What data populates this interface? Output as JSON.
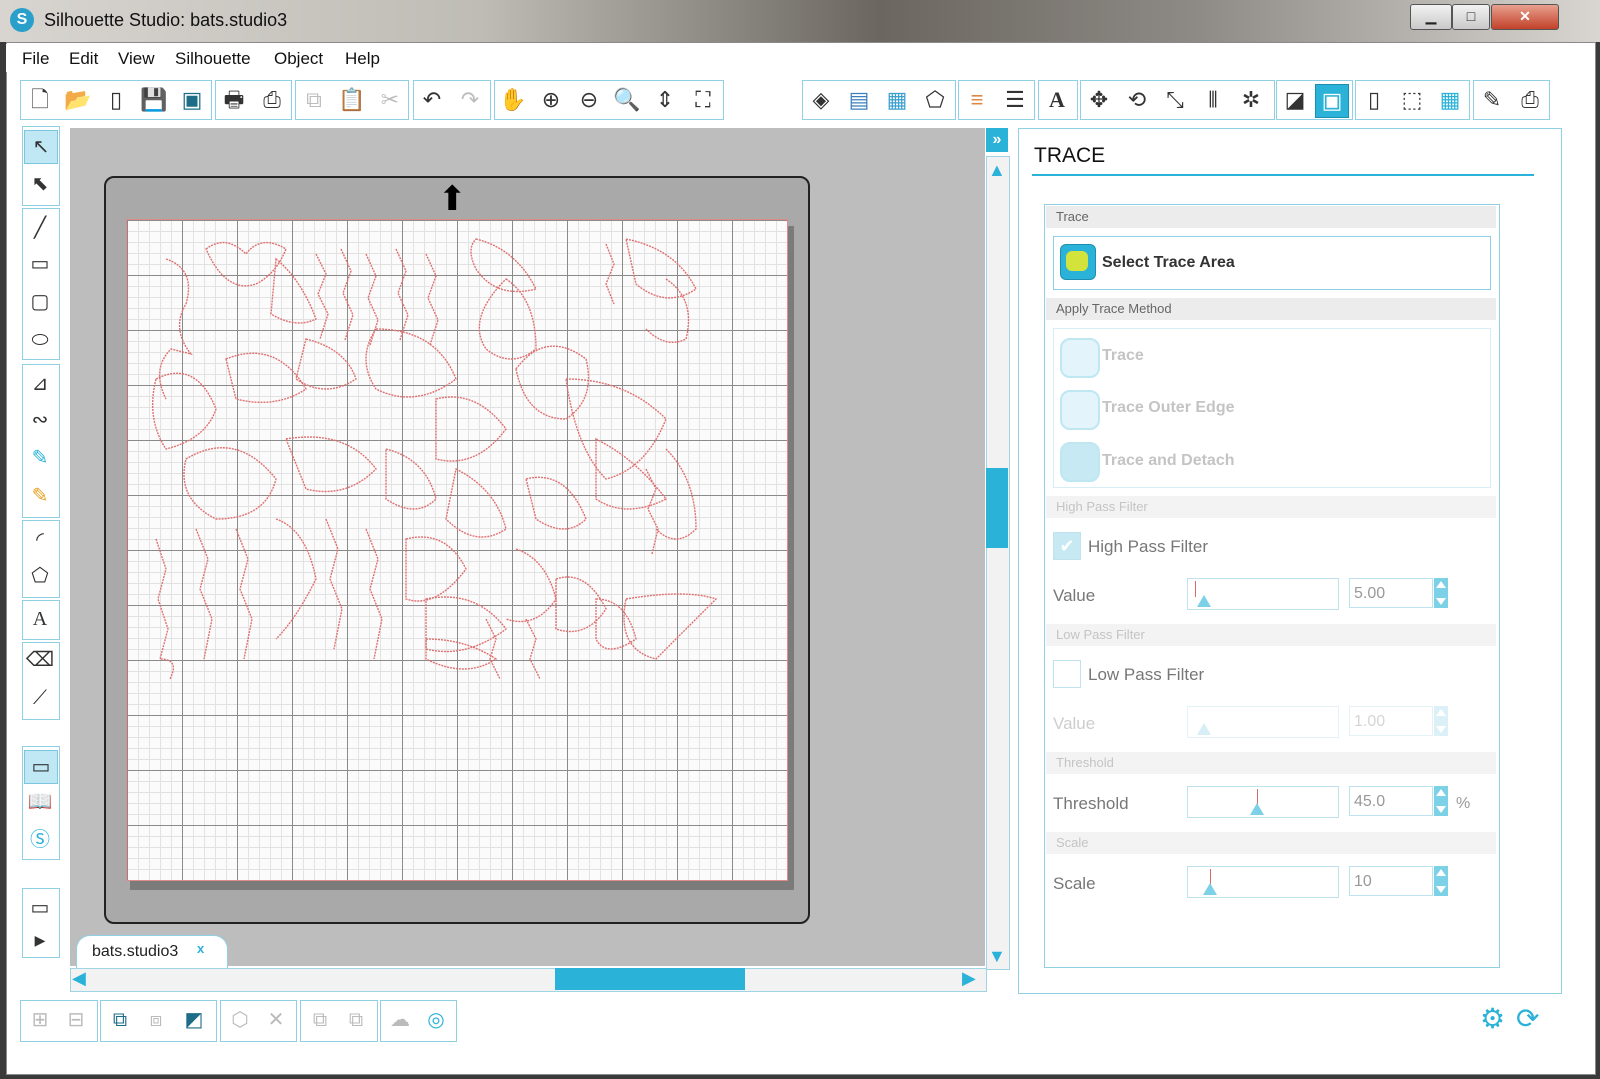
{
  "window": {
    "title": "Silhouette Studio: bats.studio3",
    "controls": {
      "minimize": "▁",
      "maximize": "□",
      "close": "✕"
    }
  },
  "menubar": [
    "File",
    "Edit",
    "View",
    "Silhouette",
    "Object",
    "Help"
  ],
  "toolbar": {
    "left_icons": [
      "new-document",
      "open-folder",
      "cutting-mat",
      "save",
      "save-to-library",
      "print",
      "send-to-silhouette",
      "copy",
      "paste",
      "cut",
      "undo",
      "redo",
      "pan-hand",
      "zoom-in",
      "zoom-out",
      "zoom-selection",
      "drag-zoom",
      "fit-to-page"
    ],
    "right_icons": [
      "fill-color",
      "gradient-fill",
      "fill-pattern",
      "line-color",
      "line-color-lines",
      "line-style",
      "text-style",
      "transform",
      "rotate",
      "scale",
      "align",
      "replicate",
      "offset-modify",
      "trace",
      "page-setup",
      "cut-settings",
      "grid",
      "knife",
      "send-to-cutter"
    ],
    "active": "trace"
  },
  "tools": [
    "select-arrow",
    "point-edit",
    "line",
    "rectangle",
    "rounded-rectangle",
    "ellipse",
    "polygon-draw",
    "curve-draw",
    "freehand",
    "smooth-freehand",
    "arc",
    "regular-polygon",
    "text",
    "eraser",
    "knife-tool",
    "design-area",
    "library",
    "online-store",
    "show-hide-panel",
    "play"
  ],
  "canvas": {
    "doc_tab": "bats.studio3",
    "doc_tab_close": "x",
    "grid_cells": 12
  },
  "panel": {
    "title": "TRACE",
    "section_trace": "Trace",
    "select_trace_area": "Select Trace Area",
    "section_apply": "Apply Trace Method",
    "methods": [
      "Trace",
      "Trace Outer Edge",
      "Trace and Detach"
    ],
    "section_high_pass": "High Pass Filter",
    "high_pass_label": "High Pass Filter",
    "high_pass_checked": true,
    "high_pass_value_label": "Value",
    "high_pass_value": "5.00",
    "high_pass_level": 0.05,
    "section_low_pass": "Low Pass Filter",
    "low_pass_label": "Low Pass Filter",
    "low_pass_checked": false,
    "low_pass_value_label": "Value",
    "low_pass_value": "1.00",
    "low_pass_level": 0.05,
    "section_threshold": "Threshold",
    "threshold_label": "Threshold",
    "threshold_value": "45.0",
    "threshold_unit": "%",
    "threshold_level": 0.45,
    "section_scale": "Scale",
    "scale_label": "Scale",
    "scale_value": "10",
    "scale_level": 0.1
  },
  "colors": {
    "accent": "#2ab2d8",
    "cut_line": "#e07070",
    "mat_grid": "#8a8a8a"
  }
}
